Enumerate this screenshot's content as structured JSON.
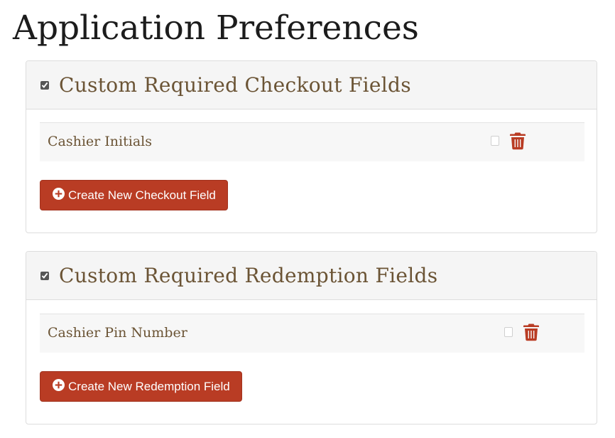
{
  "page": {
    "title": "Application Preferences"
  },
  "sections": [
    {
      "title": "Custom Required Checkout Fields",
      "enabled": true,
      "fields": [
        {
          "label": "Cashier Initials",
          "checked": false
        }
      ],
      "create_button_label": "Create New Checkout Field"
    },
    {
      "title": "Custom Required Redemption Fields",
      "enabled": true,
      "fields": [
        {
          "label": "Cashier Pin Number",
          "checked": false
        }
      ],
      "create_button_label": "Create New Redemption Field"
    }
  ],
  "icons": {
    "delete": "trash-icon",
    "create": "plus-circle-icon"
  },
  "colors": {
    "accent": "#b93c24",
    "heading_text": "#6b5435",
    "panel_heading_bg": "#f5f5f5"
  }
}
